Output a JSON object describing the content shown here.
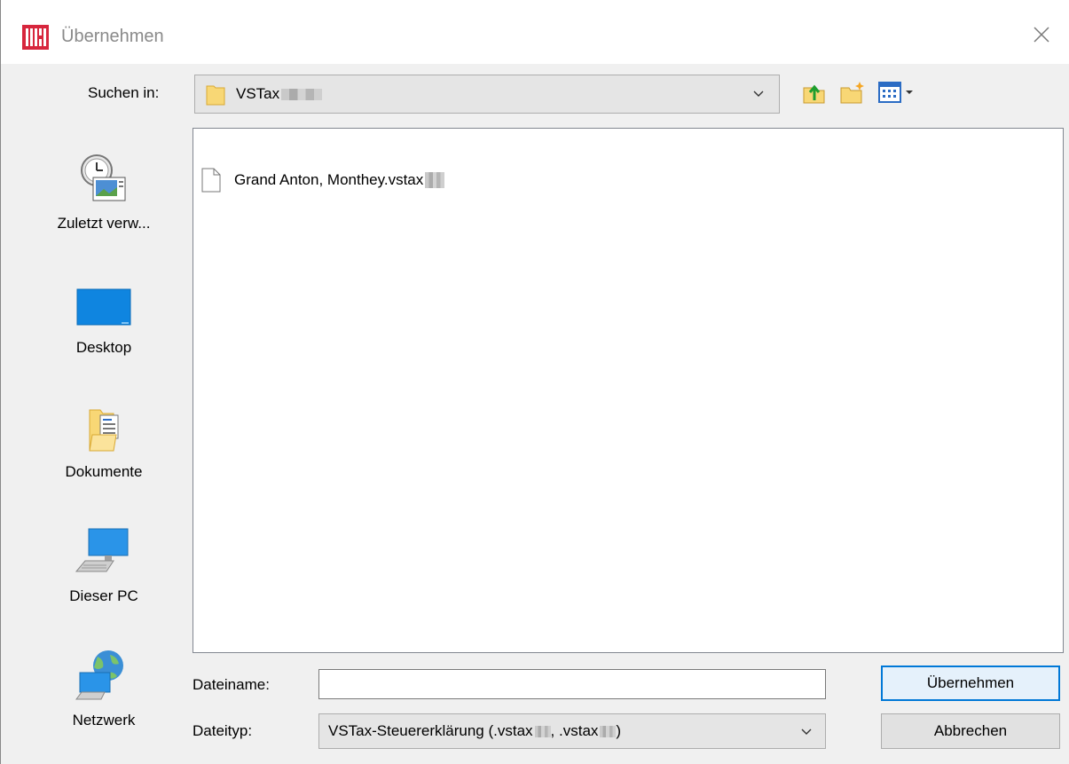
{
  "window": {
    "title": "Übernehmen",
    "close_glyph": "✕"
  },
  "look_in": {
    "label": "Suchen in:",
    "folder_name": "VSTax"
  },
  "toolbar": {
    "icons": [
      "up-folder-icon",
      "new-folder-icon",
      "view-menu-icon"
    ]
  },
  "places": [
    {
      "label": "Zuletzt verw...",
      "icon": "recent-places-icon"
    },
    {
      "label": "Desktop",
      "icon": "desktop-icon"
    },
    {
      "label": "Dokumente",
      "icon": "documents-icon"
    },
    {
      "label": "Dieser PC",
      "icon": "this-pc-icon"
    },
    {
      "label": "Netzwerk",
      "icon": "network-icon"
    }
  ],
  "files": [
    {
      "name": "Grand Anton, Monthey.vstax",
      "icon": "file-icon"
    }
  ],
  "filename": {
    "label": "Dateiname:",
    "value": ""
  },
  "filetype": {
    "label": "Dateityp:",
    "value_start": "VSTax-Steuererklärung (.vstax",
    "value_mid": ", .vstax",
    "value_end": ")"
  },
  "buttons": {
    "ok": "Übernehmen",
    "cancel": "Abbrechen"
  },
  "colors": {
    "accent": "#0078d7",
    "app_icon_red": "#d7263d"
  }
}
